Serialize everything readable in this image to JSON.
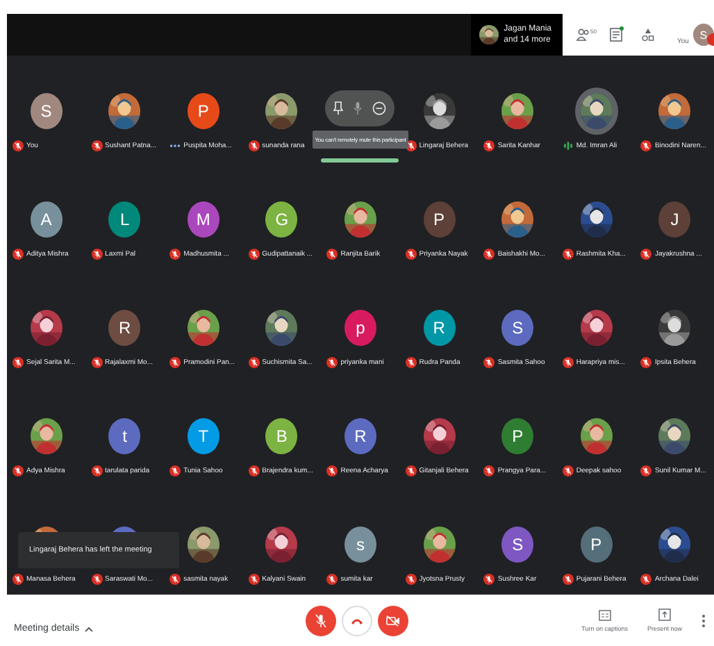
{
  "top_bar": {
    "presenter": {
      "name": "Jagan Mania",
      "more": "and 14 more"
    },
    "people_count": "50",
    "chat_unread": true,
    "self_label": "You",
    "self_avatar": {
      "letter": "S",
      "color": "#a1887f"
    },
    "self_muted": true
  },
  "tiles": [
    {
      "kind": "participant",
      "name": "You",
      "muted": true,
      "speaking": false,
      "avatar": {
        "kind": "letter",
        "letter": "S",
        "color": "#a1887f"
      }
    },
    {
      "kind": "participant",
      "name": "Sushant Patna...",
      "muted": true,
      "speaking": false
    },
    {
      "kind": "participant",
      "name": "Puspita Moha...",
      "muted": false,
      "speaking": false,
      "avatar": {
        "kind": "letter",
        "letter": "P",
        "color": "#e64a19"
      }
    },
    {
      "kind": "participant",
      "name": "sunanda rana",
      "muted": true,
      "speaking": false
    },
    {
      "kind": "hover",
      "tooltip": "You can't remotely mute this participant"
    },
    {
      "kind": "participant",
      "name": "Lingaraj Behera",
      "muted": true,
      "speaking": false
    },
    {
      "kind": "participant",
      "name": "Sarita Kanhar",
      "muted": true,
      "speaking": false
    },
    {
      "kind": "participant",
      "name": "Md. Imran Ali",
      "muted": false,
      "speaking": true
    },
    {
      "kind": "participant",
      "name": "Binodini Naren...",
      "muted": true,
      "speaking": false
    },
    {
      "kind": "participant",
      "name": "Aditya Mishra",
      "muted": true,
      "speaking": false,
      "avatar": {
        "kind": "letter",
        "letter": "A",
        "color": "#78909c"
      }
    },
    {
      "kind": "participant",
      "name": "Laxmi Pal",
      "muted": true,
      "speaking": false,
      "avatar": {
        "kind": "letter",
        "letter": "L",
        "color": "#00897b"
      }
    },
    {
      "kind": "participant",
      "name": "Madhusmita ...",
      "muted": true,
      "speaking": false,
      "avatar": {
        "kind": "letter",
        "letter": "M",
        "color": "#ab47bc"
      }
    },
    {
      "kind": "participant",
      "name": "Gudipattanaik ...",
      "muted": true,
      "speaking": false,
      "avatar": {
        "kind": "letter",
        "letter": "G",
        "color": "#7cb342"
      }
    },
    {
      "kind": "participant",
      "name": "Ranjita Barik",
      "muted": true,
      "speaking": false
    },
    {
      "kind": "participant",
      "name": "Priyanka Nayak",
      "muted": true,
      "speaking": false,
      "avatar": {
        "kind": "letter",
        "letter": "P",
        "color": "#5d4037"
      }
    },
    {
      "kind": "participant",
      "name": "Baishakhi Mo...",
      "muted": true,
      "speaking": false
    },
    {
      "kind": "participant",
      "name": "Rashmita Kha...",
      "muted": true,
      "speaking": false
    },
    {
      "kind": "participant",
      "name": "Jayakrushna ...",
      "muted": true,
      "speaking": false,
      "avatar": {
        "kind": "letter",
        "letter": "J",
        "color": "#5d4037"
      }
    },
    {
      "kind": "participant",
      "name": "Sejal Sarita M...",
      "muted": true,
      "speaking": false
    },
    {
      "kind": "participant",
      "name": "Rajalaxmi Mo...",
      "muted": true,
      "speaking": false,
      "avatar": {
        "kind": "letter",
        "letter": "R",
        "color": "#6d4c41"
      }
    },
    {
      "kind": "participant",
      "name": "Pramodini Pan...",
      "muted": true,
      "speaking": false
    },
    {
      "kind": "participant",
      "name": "Suchismita Sa...",
      "muted": true,
      "speaking": false
    },
    {
      "kind": "participant",
      "name": "priyanka mani",
      "muted": true,
      "speaking": false,
      "avatar": {
        "kind": "letter",
        "letter": "p",
        "color": "#d81b60"
      }
    },
    {
      "kind": "participant",
      "name": "Rudra Panda",
      "muted": true,
      "speaking": false,
      "avatar": {
        "kind": "letter",
        "letter": "R",
        "color": "#0097a7"
      }
    },
    {
      "kind": "participant",
      "name": "Sasmita Sahoo",
      "muted": true,
      "speaking": false,
      "avatar": {
        "kind": "letter",
        "letter": "S",
        "color": "#5c6bc0"
      }
    },
    {
      "kind": "participant",
      "name": "Harapriya mis...",
      "muted": true,
      "speaking": false
    },
    {
      "kind": "participant",
      "name": "Ipsita Behera",
      "muted": true,
      "speaking": false
    },
    {
      "kind": "participant",
      "name": "Adya Mishra",
      "muted": true,
      "speaking": false
    },
    {
      "kind": "participant",
      "name": "tarulata parida",
      "muted": true,
      "speaking": false,
      "avatar": {
        "kind": "letter",
        "letter": "t",
        "color": "#5c6bc0"
      }
    },
    {
      "kind": "participant",
      "name": "Tunia Sahoo",
      "muted": true,
      "speaking": false,
      "avatar": {
        "kind": "letter",
        "letter": "T",
        "color": "#039be5"
      }
    },
    {
      "kind": "participant",
      "name": "Brajendra kum...",
      "muted": true,
      "speaking": false,
      "avatar": {
        "kind": "letter",
        "letter": "B",
        "color": "#7cb342"
      }
    },
    {
      "kind": "participant",
      "name": "Reena Acharya",
      "muted": true,
      "speaking": false,
      "avatar": {
        "kind": "letter",
        "letter": "R",
        "color": "#5c6bc0"
      }
    },
    {
      "kind": "participant",
      "name": "Gitanjali Behera",
      "muted": true,
      "speaking": false
    },
    {
      "kind": "participant",
      "name": "Prangya Para...",
      "muted": true,
      "speaking": false,
      "avatar": {
        "kind": "letter",
        "letter": "P",
        "color": "#2e7d32"
      }
    },
    {
      "kind": "participant",
      "name": "Deepak sahoo",
      "muted": true,
      "speaking": false
    },
    {
      "kind": "participant",
      "name": "Sunil Kumar M...",
      "muted": true,
      "speaking": false
    },
    {
      "kind": "participant",
      "name": "Manasa Behera",
      "muted": true,
      "speaking": false
    },
    {
      "kind": "participant",
      "name": "Saraswati Mo...",
      "muted": true,
      "speaking": false,
      "avatar": {
        "kind": "plain",
        "color": "#5c6bc0"
      }
    },
    {
      "kind": "participant",
      "name": "sasmita nayak",
      "muted": true,
      "speaking": false
    },
    {
      "kind": "participant",
      "name": "Kalyani Swain",
      "muted": true,
      "speaking": false
    },
    {
      "kind": "participant",
      "name": "sumita kar",
      "muted": true,
      "speaking": false,
      "avatar": {
        "kind": "letter",
        "letter": "s",
        "color": "#78909c"
      }
    },
    {
      "kind": "participant",
      "name": "Jyotsna Prusty",
      "muted": true,
      "speaking": false
    },
    {
      "kind": "participant",
      "name": "Sushree Kar",
      "muted": true,
      "speaking": false,
      "avatar": {
        "kind": "letter",
        "letter": "S",
        "color": "#7e57c2"
      }
    },
    {
      "kind": "participant",
      "name": "Pujarani Behera",
      "muted": true,
      "speaking": false,
      "avatar": {
        "kind": "letter",
        "letter": "P",
        "color": "#546e7a"
      }
    },
    {
      "kind": "participant",
      "name": "Archana Dalei",
      "muted": true,
      "speaking": false
    }
  ],
  "toast": "Lingaraj Behera has left the meeting",
  "bottom_bar": {
    "meeting_details": "Meeting details",
    "mic_on": false,
    "camera_on": false,
    "captions": "Turn on captions",
    "present": "Present now"
  }
}
